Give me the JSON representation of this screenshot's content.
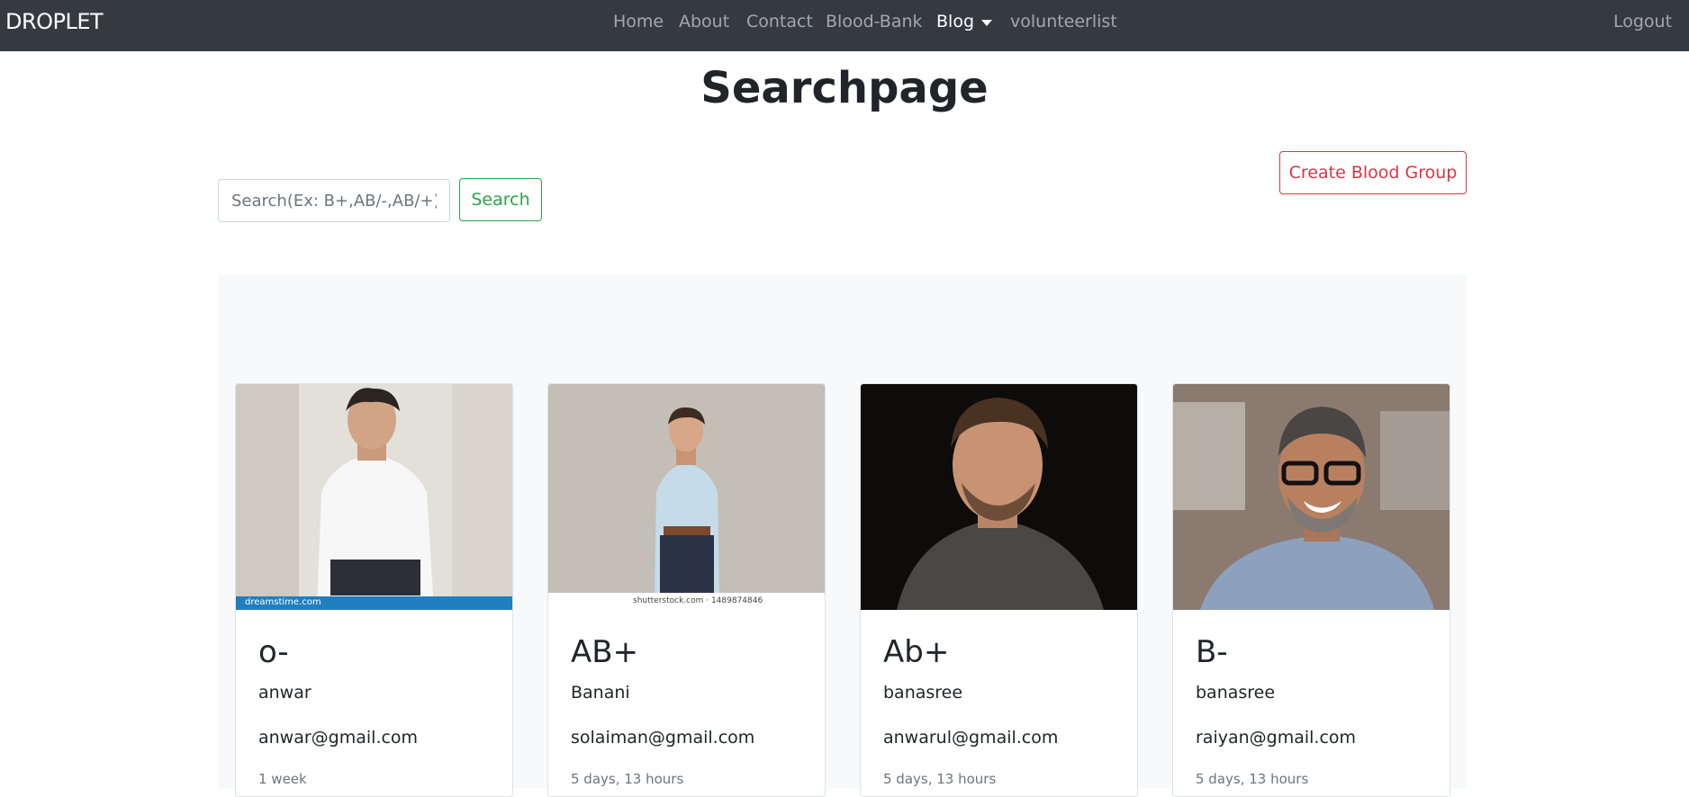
{
  "navbar": {
    "brand": "DROPLET",
    "links": [
      "Home",
      "About",
      "Contact",
      "Blood-Bank",
      "Blog",
      "volunteerlist"
    ],
    "logout": "Logout"
  },
  "page_title": "Searchpage",
  "search": {
    "placeholder": "Search(Ex: B+,AB/-,AB/+)",
    "button": "Search"
  },
  "create_button": "Create Blood Group",
  "cards": [
    {
      "blood_group": "o-",
      "name": "anwar",
      "email": "anwar@gmail.com",
      "time": "1 week",
      "watermark": "dreamstime.com"
    },
    {
      "blood_group": "AB+",
      "name": "Banani",
      "email": "solaiman@gmail.com",
      "time": "5 days, 13 hours",
      "watermark": "shutterstock.com · 1489874846"
    },
    {
      "blood_group": "Ab+",
      "name": "banasree",
      "email": "anwarul@gmail.com",
      "time": "5 days, 13 hours"
    },
    {
      "blood_group": "B-",
      "name": "banasree",
      "email": "raiyan@gmail.com",
      "time": "5 days, 13 hours"
    }
  ]
}
